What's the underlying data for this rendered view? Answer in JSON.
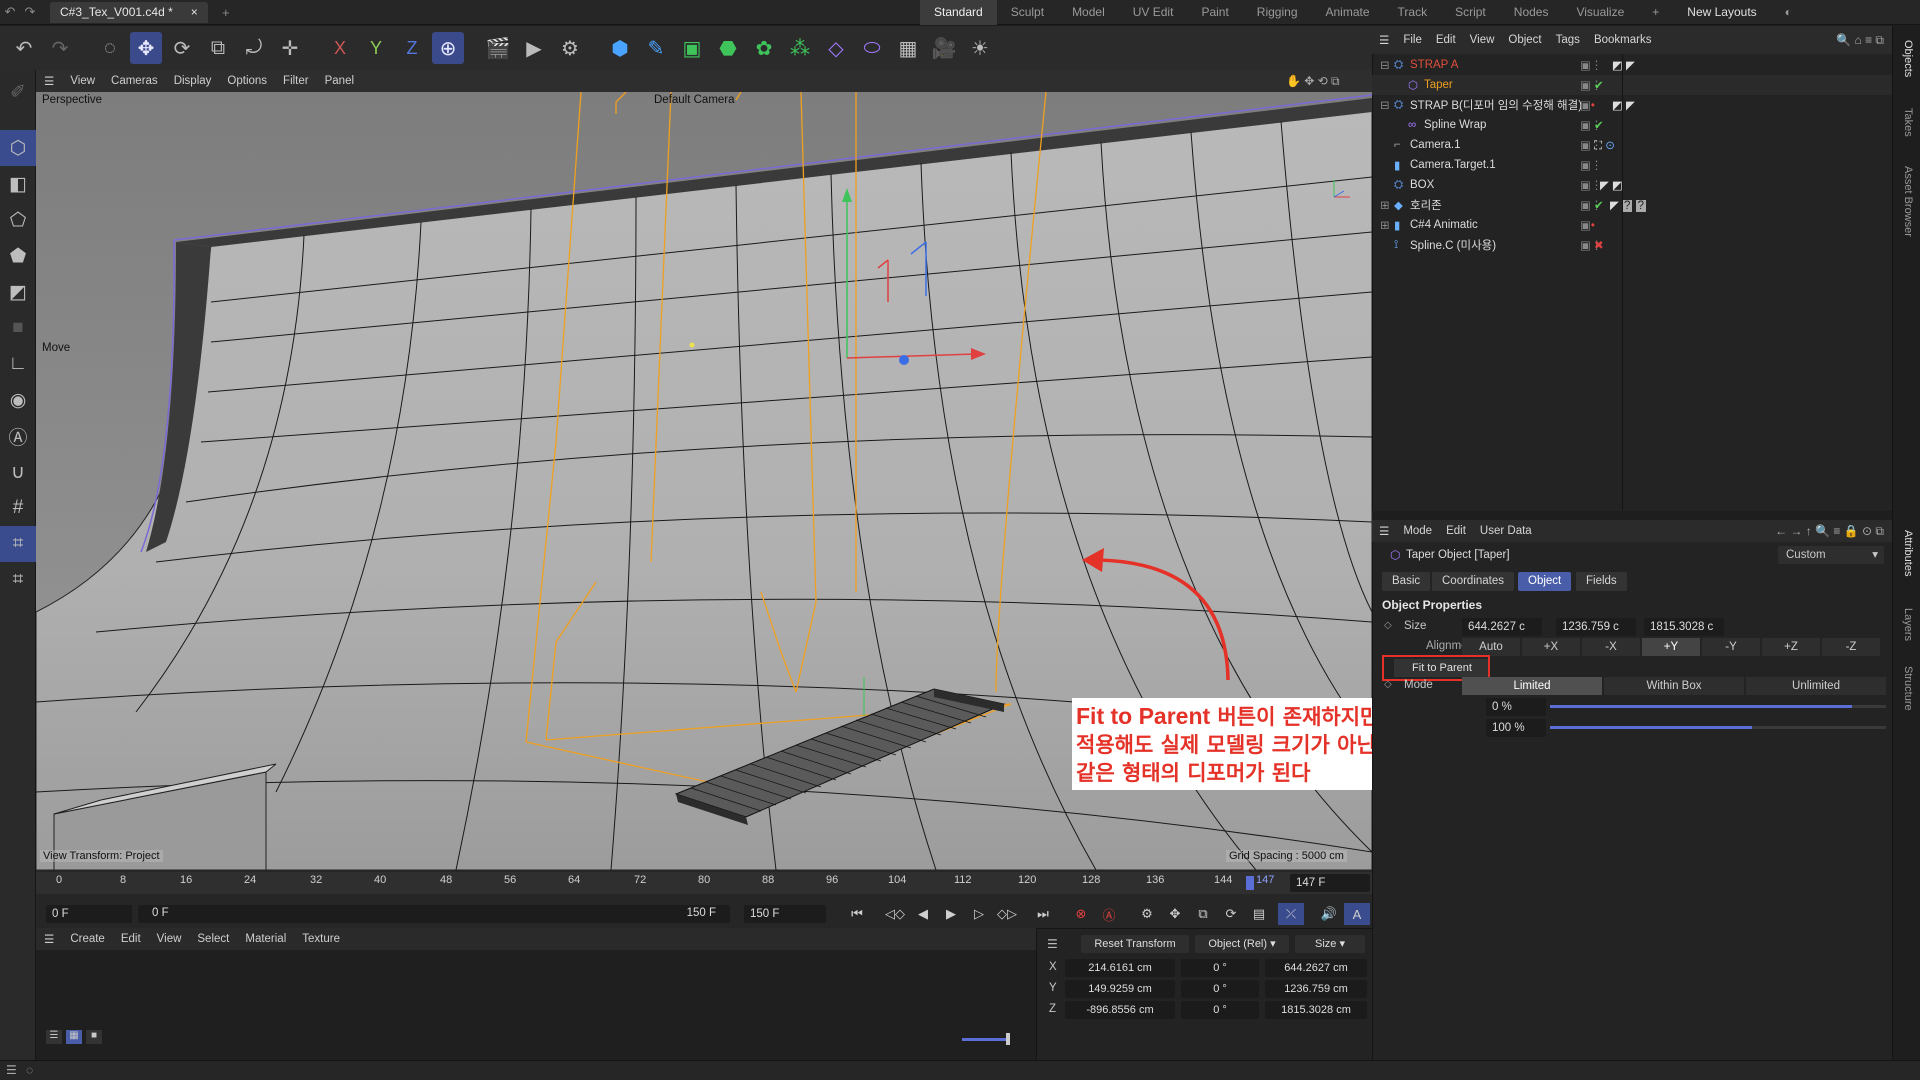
{
  "window": {
    "doc_tab": "C#3_Tex_V001.c4d *",
    "close": "×",
    "add": "+"
  },
  "layouts": [
    "Standard",
    "Sculpt",
    "Model",
    "UV Edit",
    "Paint",
    "Rigging",
    "Animate",
    "Track",
    "Script",
    "Nodes",
    "Visualize"
  ],
  "layouts_add": "+",
  "new_layouts": "New Layouts",
  "toolbar": {
    "x": "X",
    "y": "Y",
    "z": "Z"
  },
  "viewport": {
    "menu": [
      "View",
      "Cameras",
      "Display",
      "Options",
      "Filter",
      "Panel"
    ],
    "projection": "Perspective",
    "camera": "Default Camera",
    "tool_label": "Move",
    "view_transform": "View Transform: Project",
    "grid_spacing": "Grid Spacing : 5000 cm"
  },
  "timeline": {
    "ticks": [
      "0",
      "8",
      "16",
      "24",
      "32",
      "40",
      "48",
      "56",
      "64",
      "72",
      "80",
      "88",
      "96",
      "104",
      "112",
      "120",
      "128",
      "136",
      "144"
    ],
    "playhead_label": "147",
    "current_frame": "147 F",
    "start_field": "0 F",
    "range_start": "0 F",
    "range_end": "150 F",
    "end_field": "150 F"
  },
  "material_manager": {
    "menu": [
      "Create",
      "Edit",
      "View",
      "Select",
      "Material",
      "Texture"
    ]
  },
  "coords": {
    "reset": "Reset Transform",
    "space": "Object (Rel)",
    "size_mode": "Size",
    "rows": [
      {
        "axis": "X",
        "pos": "214.6161 cm",
        "rot": "0 °",
        "size": "644.2627 cm"
      },
      {
        "axis": "Y",
        "pos": "149.9259 cm",
        "rot": "0 °",
        "size": "1236.759 cm"
      },
      {
        "axis": "Z",
        "pos": "-896.8556 cm",
        "rot": "0 °",
        "size": "1815.3028 cm"
      }
    ]
  },
  "objects": {
    "menu": [
      "File",
      "Edit",
      "View",
      "Object",
      "Tags",
      "Bookmarks"
    ],
    "items": [
      {
        "name": "STRAP A",
        "color": "#e0503c"
      },
      {
        "name": "Taper",
        "color": "#f0a020"
      },
      {
        "name": "STRAP B(디포머 임의 수정해 해결)",
        "color": "#d8d8d8"
      },
      {
        "name": "Spline Wrap",
        "color": "#d8d8d8"
      },
      {
        "name": "Camera.1",
        "color": "#d8d8d8"
      },
      {
        "name": "Camera.Target.1",
        "color": "#d8d8d8"
      },
      {
        "name": "BOX",
        "color": "#d8d8d8"
      },
      {
        "name": "호리존",
        "color": "#d8d8d8"
      },
      {
        "name": "C#4 Animatic",
        "color": "#d8d8d8"
      },
      {
        "name": "Spline.C (미사용)",
        "color": "#d8d8d8"
      }
    ]
  },
  "attributes": {
    "menu": [
      "Mode",
      "Edit",
      "User Data"
    ],
    "object_title": "Taper Object [Taper]",
    "preset": "Custom",
    "tabs": [
      "Basic",
      "Coordinates",
      "Object",
      "Fields"
    ],
    "section": "Object Properties",
    "size_label": "Size",
    "size_values": [
      "644.2627 c",
      "1236.759 c",
      "1815.3028 c"
    ],
    "alignment_label": "Alignment",
    "alignment_options": [
      "Auto",
      "+X",
      "-X",
      "+Y",
      "-Y",
      "+Z",
      "-Z"
    ],
    "fit_button": "Fit to Parent",
    "mode_label": "Mode",
    "mode_options": [
      "Limited",
      "Within Box",
      "Unlimited"
    ],
    "strength_value": "0 %",
    "curvature_value": "100 %",
    "strength_fill": 0.9,
    "curvature_fill": 0.6
  },
  "side_tabs": [
    "Objects",
    "Takes",
    "Asset Browser",
    "Attributes",
    "Layers",
    "Structure"
  ],
  "annotation": {
    "line1_en": "Fit to Parent",
    "line1_ko": " 버튼이 존재하지만,",
    "line2": "적용해도 실제 모델링 크기가 아닌 이전과",
    "line3": "같은 형태의 디포머가 된다"
  },
  "colors": {
    "accent": "#4a5da8",
    "annotation_red": "#e53228",
    "deformer_orange": "#f0a020",
    "boundary_purple": "#7a6ad6"
  }
}
